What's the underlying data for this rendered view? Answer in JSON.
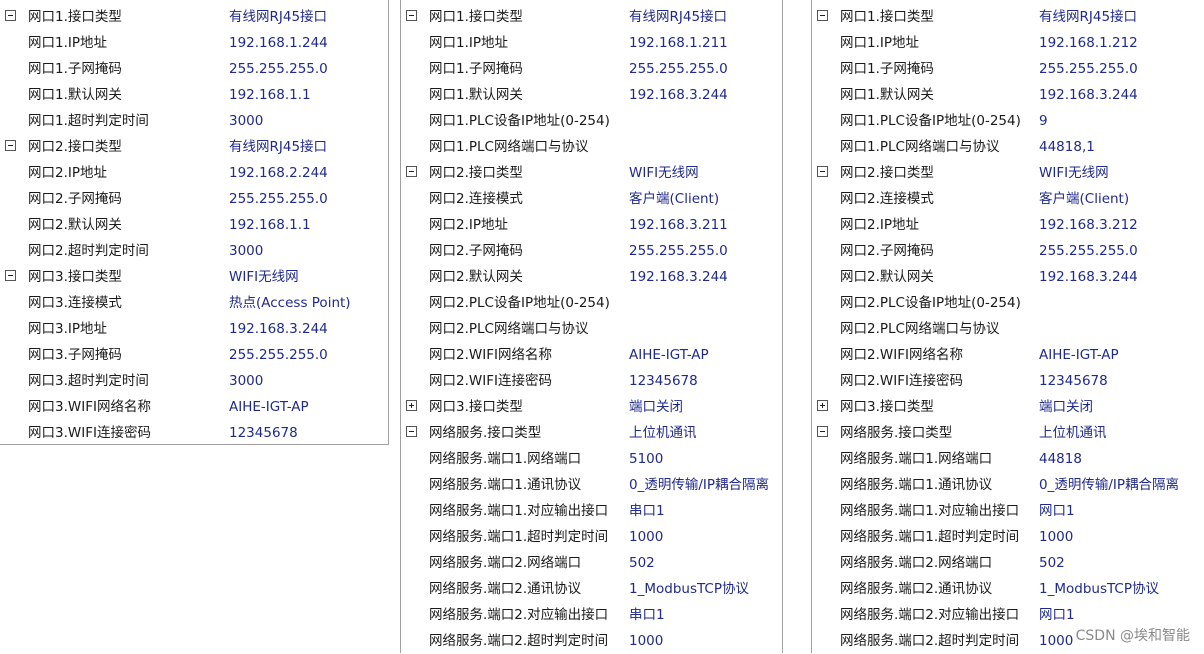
{
  "panels": [
    {
      "rows": [
        {
          "name": "网口1.接口类型",
          "value": "有线网RJ45接口",
          "toggle": "minus"
        },
        {
          "name": "网口1.IP地址",
          "value": "192.168.1.244"
        },
        {
          "name": "网口1.子网掩码",
          "value": "255.255.255.0"
        },
        {
          "name": "网口1.默认网关",
          "value": "192.168.1.1"
        },
        {
          "name": "网口1.超时判定时间",
          "value": "3000"
        },
        {
          "name": "网口2.接口类型",
          "value": "有线网RJ45接口",
          "toggle": "minus"
        },
        {
          "name": "网口2.IP地址",
          "value": "192.168.2.244"
        },
        {
          "name": "网口2.子网掩码",
          "value": "255.255.255.0"
        },
        {
          "name": "网口2.默认网关",
          "value": "192.168.1.1"
        },
        {
          "name": "网口2.超时判定时间",
          "value": "3000"
        },
        {
          "name": "网口3.接口类型",
          "value": "WIFI无线网",
          "toggle": "minus"
        },
        {
          "name": "网口3.连接模式",
          "value": "热点(Access Point)"
        },
        {
          "name": "网口3.IP地址",
          "value": "192.168.3.244"
        },
        {
          "name": "网口3.子网掩码",
          "value": "255.255.255.0"
        },
        {
          "name": "网口3.超时判定时间",
          "value": "3000"
        },
        {
          "name": "网口3.WIFI网络名称",
          "value": "AIHE-IGT-AP"
        },
        {
          "name": "网口3.WIFI连接密码",
          "value": "12345678"
        }
      ]
    },
    {
      "rows": [
        {
          "name": "网口1.接口类型",
          "value": "有线网RJ45接口",
          "toggle": "minus"
        },
        {
          "name": "网口1.IP地址",
          "value": "192.168.1.211"
        },
        {
          "name": "网口1.子网掩码",
          "value": "255.255.255.0"
        },
        {
          "name": "网口1.默认网关",
          "value": "192.168.3.244"
        },
        {
          "name": "网口1.PLC设备IP地址(0-254)",
          "value": ""
        },
        {
          "name": "网口1.PLC网络端口与协议",
          "value": ""
        },
        {
          "name": "网口2.接口类型",
          "value": "WIFI无线网",
          "toggle": "minus"
        },
        {
          "name": "网口2.连接模式",
          "value": "客户端(Client)"
        },
        {
          "name": "网口2.IP地址",
          "value": "192.168.3.211"
        },
        {
          "name": "网口2.子网掩码",
          "value": "255.255.255.0"
        },
        {
          "name": "网口2.默认网关",
          "value": "192.168.3.244"
        },
        {
          "name": "网口2.PLC设备IP地址(0-254)",
          "value": ""
        },
        {
          "name": "网口2.PLC网络端口与协议",
          "value": ""
        },
        {
          "name": "网口2.WIFI网络名称",
          "value": "AIHE-IGT-AP"
        },
        {
          "name": "网口2.WIFI连接密码",
          "value": "12345678"
        },
        {
          "name": "网口3.接口类型",
          "value": "端口关闭",
          "toggle": "plus"
        },
        {
          "name": "网络服务.接口类型",
          "value": "上位机通讯",
          "toggle": "minus"
        },
        {
          "name": "网络服务.端口1.网络端口",
          "value": "5100"
        },
        {
          "name": "网络服务.端口1.通讯协议",
          "value": "0_透明传输/IP耦合隔离"
        },
        {
          "name": "网络服务.端口1.对应输出接口",
          "value": "串口1"
        },
        {
          "name": "网络服务.端口1.超时判定时间",
          "value": "1000"
        },
        {
          "name": "网络服务.端口2.网络端口",
          "value": "502"
        },
        {
          "name": "网络服务.端口2.通讯协议",
          "value": "1_ModbusTCP协议"
        },
        {
          "name": "网络服务.端口2.对应输出接口",
          "value": "串口1"
        },
        {
          "name": "网络服务.端口2.超时判定时间",
          "value": "1000"
        }
      ]
    },
    {
      "rows": [
        {
          "name": "网口1.接口类型",
          "value": "有线网RJ45接口",
          "toggle": "minus"
        },
        {
          "name": "网口1.IP地址",
          "value": "192.168.1.212"
        },
        {
          "name": "网口1.子网掩码",
          "value": "255.255.255.0"
        },
        {
          "name": "网口1.默认网关",
          "value": "192.168.3.244"
        },
        {
          "name": "网口1.PLC设备IP地址(0-254)",
          "value": "9"
        },
        {
          "name": "网口1.PLC网络端口与协议",
          "value": "44818,1"
        },
        {
          "name": "网口2.接口类型",
          "value": "WIFI无线网",
          "toggle": "minus"
        },
        {
          "name": "网口2.连接模式",
          "value": "客户端(Client)"
        },
        {
          "name": "网口2.IP地址",
          "value": "192.168.3.212"
        },
        {
          "name": "网口2.子网掩码",
          "value": "255.255.255.0"
        },
        {
          "name": "网口2.默认网关",
          "value": "192.168.3.244"
        },
        {
          "name": "网口2.PLC设备IP地址(0-254)",
          "value": ""
        },
        {
          "name": "网口2.PLC网络端口与协议",
          "value": ""
        },
        {
          "name": "网口2.WIFI网络名称",
          "value": "AIHE-IGT-AP"
        },
        {
          "name": "网口2.WIFI连接密码",
          "value": "12345678"
        },
        {
          "name": "网口3.接口类型",
          "value": "端口关闭",
          "toggle": "plus"
        },
        {
          "name": "网络服务.接口类型",
          "value": "上位机通讯",
          "toggle": "minus"
        },
        {
          "name": "网络服务.端口1.网络端口",
          "value": "44818"
        },
        {
          "name": "网络服务.端口1.通讯协议",
          "value": "0_透明传输/IP耦合隔离"
        },
        {
          "name": "网络服务.端口1.对应输出接口",
          "value": "网口1"
        },
        {
          "name": "网络服务.端口1.超时判定时间",
          "value": "1000"
        },
        {
          "name": "网络服务.端口2.网络端口",
          "value": "502"
        },
        {
          "name": "网络服务.端口2.通讯协议",
          "value": "1_ModbusTCP协议"
        },
        {
          "name": "网络服务.端口2.对应输出接口",
          "value": "网口1"
        },
        {
          "name": "网络服务.端口2.超时判定时间",
          "value": "1000"
        }
      ]
    }
  ],
  "watermark": "CSDN @埃和智能",
  "colors": {
    "value_text": "#1f2a8c",
    "name_text": "#1a1a1a",
    "border": "#a0a0a0"
  }
}
